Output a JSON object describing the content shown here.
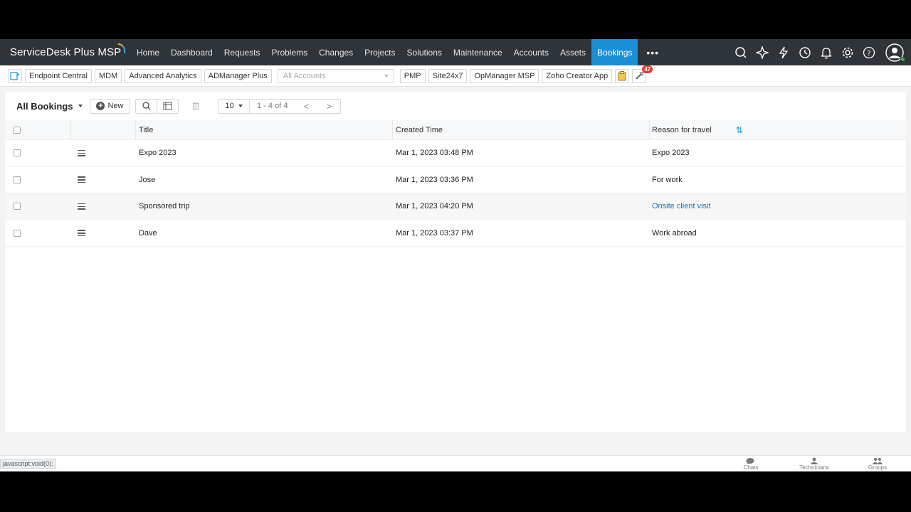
{
  "app": {
    "brand": "ServiceDesk Plus MSP"
  },
  "nav": {
    "items": [
      "Home",
      "Dashboard",
      "Requests",
      "Problems",
      "Changes",
      "Projects",
      "Solutions",
      "Maintenance",
      "Accounts",
      "Assets",
      "Bookings"
    ],
    "active": "Bookings",
    "more": "•••",
    "icons": [
      "search-icon",
      "sparkle-icon",
      "lightning-icon",
      "history-icon",
      "bell-icon",
      "gear-icon",
      "help-icon",
      "avatar"
    ]
  },
  "integrations": {
    "buttons": [
      "Endpoint Central",
      "MDM",
      "Advanced Analytics",
      "ADManager Plus"
    ],
    "account_select": "All Accounts",
    "buttons2": [
      "PMP",
      "Site24x7",
      "OpManager MSP",
      "Zoho Creator App"
    ],
    "badge": "47"
  },
  "listview": {
    "view_name": "All Bookings",
    "new_label": "New",
    "page_size": "10",
    "range": "1 - 4 of 4",
    "prev": "<",
    "next": ">"
  },
  "table": {
    "columns": {
      "title": "Title",
      "created": "Created Time",
      "reason": "Reason for travel"
    },
    "rows": [
      {
        "title": "Expo 2023",
        "created": "Mar 1, 2023 03:48 PM",
        "reason": "Expo 2023"
      },
      {
        "title": "Jose",
        "created": "Mar 1, 2023 03:36 PM",
        "reason": "For work"
      },
      {
        "title": "Sponsored trip",
        "created": "Mar 1, 2023 04:20 PM",
        "reason": "Onsite client visit"
      },
      {
        "title": "Dave",
        "created": "Mar 1, 2023 03:37 PM",
        "reason": "Work abroad"
      }
    ]
  },
  "statusbar": {
    "url": "javascript:void(0);",
    "items": [
      "Chats",
      "Technicians",
      "Groups"
    ]
  },
  "colors": {
    "nav_bg": "#2f3438",
    "accent": "#1a8fd6",
    "link": "#1a6fb8"
  }
}
